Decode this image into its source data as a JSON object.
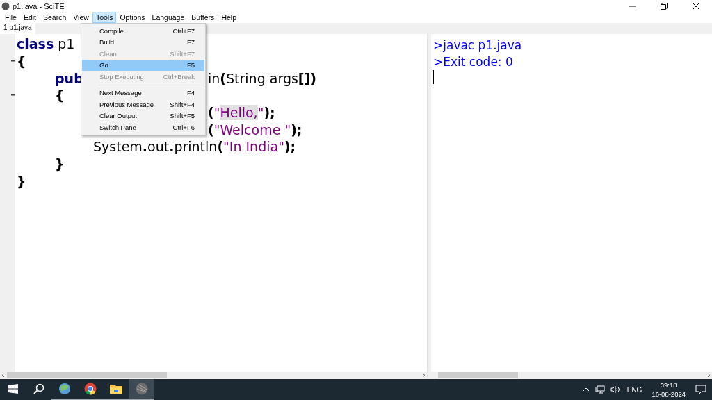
{
  "window": {
    "title": "p1.java - SciTE"
  },
  "menubar": [
    {
      "label": "File",
      "selected": false
    },
    {
      "label": "Edit",
      "selected": false
    },
    {
      "label": "Search",
      "selected": false
    },
    {
      "label": "View",
      "selected": false
    },
    {
      "label": "Tools",
      "selected": true
    },
    {
      "label": "Options",
      "selected": false
    },
    {
      "label": "Language",
      "selected": false
    },
    {
      "label": "Buffers",
      "selected": false
    },
    {
      "label": "Help",
      "selected": false
    }
  ],
  "tabs": [
    {
      "label": "1 p1.java",
      "selected": true
    }
  ],
  "editor": {
    "lines": [
      {
        "fold": false,
        "head": [
          {
            "text": "class",
            "kind": "keyword"
          },
          {
            "text": " p1",
            "kind": "plain"
          }
        ]
      },
      {
        "fold": true,
        "head": [
          {
            "text": "{",
            "kind": "operator"
          }
        ]
      },
      {
        "fold": false,
        "head": [
          {
            "text": "\tpub",
            "kind": "keyword"
          }
        ],
        "tail": [
          {
            "text": "in",
            "kind": "plain"
          },
          {
            "text": "(",
            "kind": "operator"
          },
          {
            "text": "String args",
            "kind": "plain"
          },
          {
            "text": "[])",
            "kind": "operator"
          }
        ]
      },
      {
        "fold": true,
        "head": [
          {
            "text": "\t{",
            "kind": "operator"
          }
        ]
      },
      {
        "fold": false,
        "tail": [
          {
            "text": "(",
            "kind": "operator"
          },
          {
            "text": "\"",
            "kind": "string"
          },
          {
            "text": "Hello,",
            "kind": "string",
            "highlighted": true
          },
          {
            "text": "\"",
            "kind": "string"
          },
          {
            "text": ");",
            "kind": "operator"
          }
        ]
      },
      {
        "fold": false,
        "tail": [
          {
            "text": "(",
            "kind": "operator"
          },
          {
            "text": "\"Welcome \"",
            "kind": "string"
          },
          {
            "text": ");",
            "kind": "operator"
          }
        ]
      },
      {
        "fold": false,
        "head": [
          {
            "text": "\t\tSystem",
            "kind": "plain"
          },
          {
            "text": ".",
            "kind": "operator"
          },
          {
            "text": "out",
            "kind": "plain"
          },
          {
            "text": ".",
            "kind": "operator"
          },
          {
            "text": "println",
            "kind": "plain"
          },
          {
            "text": "(",
            "kind": "operator"
          },
          {
            "text": "\"In India\"",
            "kind": "string"
          },
          {
            "text": ");",
            "kind": "operator"
          }
        ]
      },
      {
        "fold": false,
        "head": [
          {
            "text": "\t}",
            "kind": "operator"
          }
        ]
      },
      {
        "fold": false,
        "head": [
          {
            "text": "}",
            "kind": "operator"
          }
        ]
      }
    ]
  },
  "tools_menu": [
    {
      "kind": "item",
      "label": "Compile",
      "shortcut": "Ctrl+F7",
      "disabled": false,
      "selected": false
    },
    {
      "kind": "item",
      "label": "Build",
      "shortcut": "F7",
      "disabled": false,
      "selected": false
    },
    {
      "kind": "item",
      "label": "Clean",
      "shortcut": "Shift+F7",
      "disabled": true,
      "selected": false
    },
    {
      "kind": "item",
      "label": "Go",
      "shortcut": "F5",
      "disabled": false,
      "selected": true
    },
    {
      "kind": "item",
      "label": "Stop Executing",
      "shortcut": "Ctrl+Break",
      "disabled": true,
      "selected": false
    },
    {
      "kind": "separator"
    },
    {
      "kind": "item",
      "label": "Next Message",
      "shortcut": "F4",
      "disabled": false,
      "selected": false
    },
    {
      "kind": "item",
      "label": "Previous Message",
      "shortcut": "Shift+F4",
      "disabled": false,
      "selected": false
    },
    {
      "kind": "item",
      "label": "Clear Output",
      "shortcut": "Shift+F5",
      "disabled": false,
      "selected": false
    },
    {
      "kind": "item",
      "label": "Switch Pane",
      "shortcut": "Ctrl+F6",
      "disabled": false,
      "selected": false
    }
  ],
  "output": {
    "lines": [
      ">javac p1.java",
      ">Exit code: 0"
    ]
  },
  "taskbar": {
    "apps": [
      {
        "kind": "start"
      },
      {
        "kind": "search"
      },
      {
        "kind": "globe",
        "selected": false
      },
      {
        "kind": "chrome",
        "selected": false
      },
      {
        "kind": "folder",
        "selected": false
      },
      {
        "kind": "scite",
        "selected": true
      }
    ],
    "language": "ENG",
    "time": "09:18",
    "date": "16-08-2024"
  }
}
